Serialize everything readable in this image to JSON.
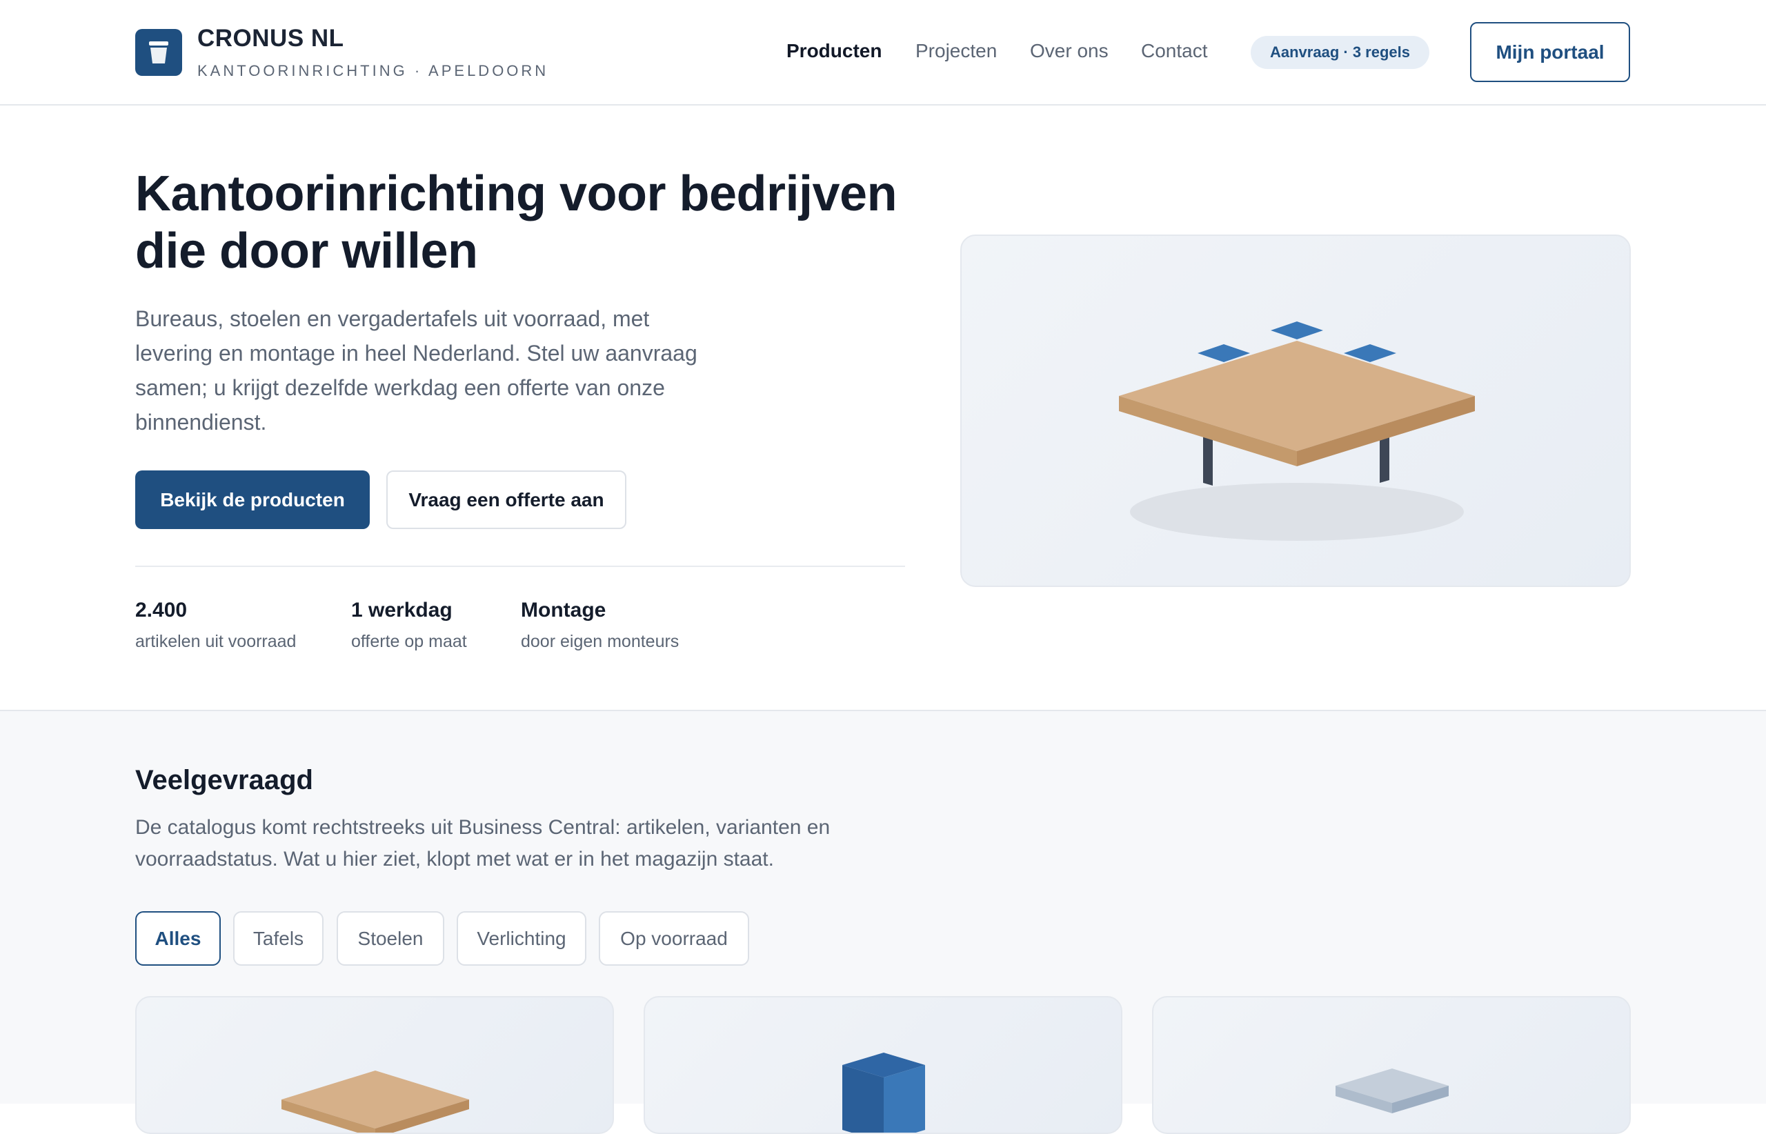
{
  "header": {
    "brand_name": "CRONUS NL",
    "brand_tagline": "KANTOORINRICHTING · APELDOORN",
    "nav": [
      "Producten",
      "Projecten",
      "Over ons",
      "Contact"
    ],
    "active_nav": "Producten",
    "request_badge": "Aanvraag · 3 regels",
    "portal_button": "Mijn portaal"
  },
  "hero": {
    "title": "Kantoorinrichting voor bedrijven die door willen",
    "subtitle": "Bureaus, stoelen en vergadertafels uit voorraad, met levering en montage in heel Nederland. Stel uw aanvraag samen; u krijgt dezelfde werkdag een offerte van onze binnendienst.",
    "primary_button": "Bekijk de producten",
    "secondary_button": "Vraag een offerte aan",
    "stats": [
      {
        "value": "2.400",
        "label": "artikelen uit voorraad"
      },
      {
        "value": "1 werkdag",
        "label": "offerte op maat"
      },
      {
        "value": "Montage",
        "label": "door eigen monteurs"
      }
    ],
    "illustration_icon": "isometric-table-icon"
  },
  "catalog": {
    "title": "Veelgevraagd",
    "subtitle": "De catalogus komt rechtstreeks uit Business Central: artikelen, varianten en voorraadstatus. Wat u hier ziet, klopt met wat er in het magazijn staat.",
    "filters": [
      "Alles",
      "Tafels",
      "Stoelen",
      "Verlichting",
      "Op voorraad"
    ],
    "active_filter": "Alles",
    "cards": [
      {
        "icon": "table-product-icon"
      },
      {
        "icon": "cabinet-product-icon"
      },
      {
        "icon": "lamp-product-icon"
      }
    ]
  },
  "colors": {
    "brand": "#1f4f80",
    "wood": "#d6b089",
    "accent_blue": "#3a78b8",
    "text_muted": "#5b6574"
  }
}
